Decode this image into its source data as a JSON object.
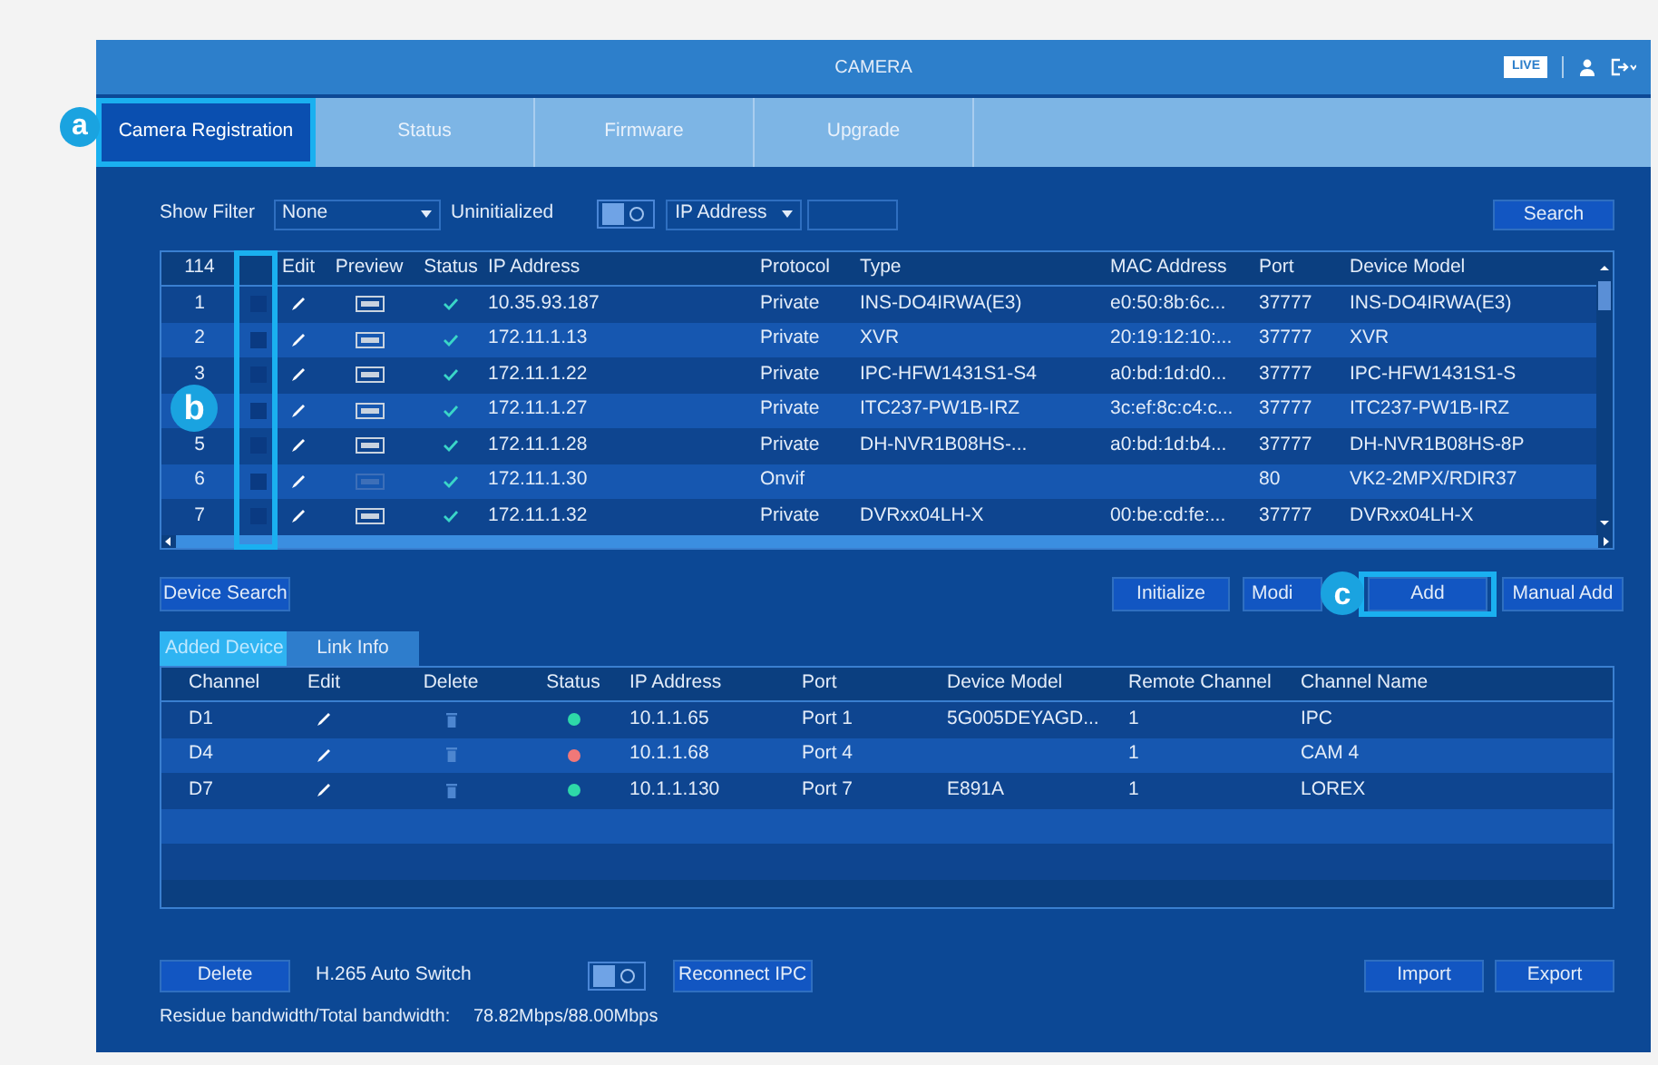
{
  "window": {
    "title": "CAMERA",
    "live_badge": "LIVE"
  },
  "tabs": [
    {
      "label": "Camera Registration",
      "selected": true
    },
    {
      "label": "Status",
      "selected": false
    },
    {
      "label": "Firmware",
      "selected": false
    },
    {
      "label": "Upgrade",
      "selected": false
    }
  ],
  "filter": {
    "label": "Show Filter",
    "dropdown": "None",
    "uninitialized_label": "Uninitialized",
    "toggle_on": false,
    "field_dropdown": "IP Address",
    "search_button": "Search"
  },
  "device_table": {
    "count": "114",
    "columns": [
      "Edit",
      "Preview",
      "Status",
      "IP Address",
      "Protocol",
      "Type",
      "MAC Address",
      "Port",
      "Device Model"
    ],
    "rows": [
      {
        "no": "1",
        "checked": false,
        "preview_disabled": false,
        "online": true,
        "ip": "10.35.93.187",
        "protocol": "Private",
        "type": "INS-DO4IRWA(E3)",
        "mac": "e0:50:8b:6c...",
        "port": "37777",
        "model": "INS-DO4IRWA(E3)"
      },
      {
        "no": "2",
        "checked": false,
        "preview_disabled": false,
        "online": true,
        "ip": "172.11.1.13",
        "protocol": "Private",
        "type": "XVR",
        "mac": "20:19:12:10:...",
        "port": "37777",
        "model": "XVR"
      },
      {
        "no": "3",
        "checked": false,
        "preview_disabled": false,
        "online": true,
        "ip": "172.11.1.22",
        "protocol": "Private",
        "type": "IPC-HFW1431S1-S4",
        "mac": "a0:bd:1d:d0...",
        "port": "37777",
        "model": "IPC-HFW1431S1-S"
      },
      {
        "checked": false,
        "preview_disabled": false,
        "online": true,
        "ip": "172.11.1.27",
        "protocol": "Private",
        "type": "ITC237-PW1B-IRZ",
        "mac": "3c:ef:8c:c4:c...",
        "port": "37777",
        "model": "ITC237-PW1B-IRZ"
      },
      {
        "no": "5",
        "checked": false,
        "preview_disabled": false,
        "online": true,
        "ip": "172.11.1.28",
        "protocol": "Private",
        "type": "DH-NVR1B08HS-...",
        "mac": "a0:bd:1d:b4...",
        "port": "37777",
        "model": "DH-NVR1B08HS-8P"
      },
      {
        "no": "6",
        "checked": false,
        "preview_disabled": true,
        "online": true,
        "ip": "172.11.1.30",
        "protocol": "Onvif",
        "port": "80",
        "model": "VK2-2MPX/RDIR37"
      },
      {
        "no": "7",
        "checked": false,
        "preview_disabled": false,
        "online": true,
        "ip": "172.11.1.32",
        "protocol": "Private",
        "type": "DVRxx04LH-X",
        "mac": "00:be:cd:fe:...",
        "port": "37777",
        "model": "DVRxx04LH-X"
      }
    ]
  },
  "device_search_button": "Device Search",
  "action_buttons": [
    "Initialize",
    "Modi",
    "Add",
    "Manual Add"
  ],
  "sub_tabs": [
    {
      "label": "Added Device",
      "selected": true
    },
    {
      "label": "Link Info",
      "selected": false
    }
  ],
  "added_table": {
    "columns": [
      "Channel",
      "Edit",
      "Delete",
      "Status",
      "IP Address",
      "Port",
      "Device Model",
      "Remote Channel",
      "Channel Name"
    ],
    "rows": [
      {
        "channel": "D1",
        "color": "#2ed8a8",
        "ip": "10.1.1.65",
        "port": "Port 1",
        "model": "5G005DEYAGD...",
        "remote": "1",
        "name": "IPC"
      },
      {
        "channel": "D4",
        "color": "#f07878",
        "ip": "10.1.1.68",
        "port": "Port 4",
        "remote": "1",
        "name": "CAM 4"
      },
      {
        "channel": "D7",
        "color": "#2ed8a8",
        "ip": "10.1.1.130",
        "port": "Port 7",
        "model": "E891A",
        "remote": "1",
        "name": "LOREX"
      }
    ]
  },
  "bottom": {
    "delete_button": "Delete",
    "h265_label": "H.265 Auto Switch",
    "h265_on": false,
    "reconnect_button": "Reconnect IPC",
    "import_button": "Import",
    "export_button": "Export",
    "bandwidth_label": "Residue bandwidth/Total bandwidth:",
    "bandwidth_value": "78.82Mbps/88.00Mbps"
  },
  "annotations": [
    {
      "label": "a"
    },
    {
      "label": "b"
    },
    {
      "label": "c"
    }
  ]
}
